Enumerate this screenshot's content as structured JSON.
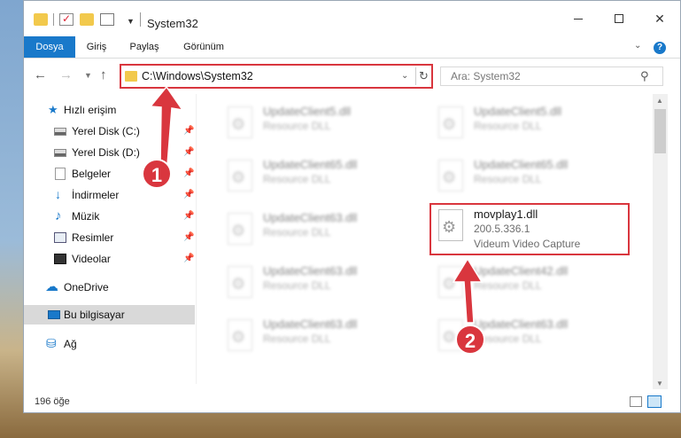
{
  "window": {
    "title": "System32",
    "help_glyph": "?"
  },
  "ribbon": {
    "tabs": [
      "Dosya",
      "Giriş",
      "Paylaş",
      "Görünüm"
    ]
  },
  "nav": {
    "address": "C:\\Windows\\System32",
    "search_placeholder": "Ara: System32"
  },
  "sidebar": {
    "items": [
      {
        "label": "Hızlı erişim",
        "icon": "star-icon"
      },
      {
        "label": "Yerel Disk (C:)",
        "icon": "drive-icon",
        "pinned": true
      },
      {
        "label": "Yerel Disk (D:)",
        "icon": "drive-icon",
        "pinned": true
      },
      {
        "label": "Belgeler",
        "icon": "documents-icon",
        "pinned": true
      },
      {
        "label": "İndirmeler",
        "icon": "download-icon",
        "pinned": true
      },
      {
        "label": "Müzik",
        "icon": "music-icon",
        "pinned": true
      },
      {
        "label": "Resimler",
        "icon": "pictures-icon",
        "pinned": true
      },
      {
        "label": "Videolar",
        "icon": "videos-icon",
        "pinned": true
      },
      {
        "label": "OneDrive",
        "icon": "cloud-icon"
      },
      {
        "label": "Bu bilgisayar",
        "icon": "computer-icon",
        "selected": true
      },
      {
        "label": "Ağ",
        "icon": "network-icon"
      }
    ]
  },
  "files": [
    {
      "name": "UpdateClient5.dll",
      "type": "Resource DLL"
    },
    {
      "name": "UpdateClient5.dll",
      "type": "Resource DLL"
    },
    {
      "name": "UpdateClient65.dll",
      "type": "Resource DLL"
    },
    {
      "name": "UpdateClient65.dll",
      "type": "Resource DLL"
    },
    {
      "name": "UpdateClient63.dll",
      "type": "Resource DLL"
    },
    {
      "name": "movplay1.dll",
      "version": "200.5.336.1",
      "description": "Videum Video Capture",
      "highlighted": true
    },
    {
      "name": "UpdateClient63.dll",
      "type": "Resource DLL"
    },
    {
      "name": "UpdateClient42.dll",
      "type": "Resource DLL"
    },
    {
      "name": "UpdateClient63.dll",
      "type": "Resource DLL"
    },
    {
      "name": "UpdateClient63.dll",
      "type": "Resource DLL"
    }
  ],
  "status": {
    "item_count": "196 öğe"
  },
  "annotations": {
    "marker1": "1",
    "marker2": "2",
    "color": "#d9363e"
  },
  "colors": {
    "accent": "#1979ca",
    "highlight": "#d9363e"
  }
}
